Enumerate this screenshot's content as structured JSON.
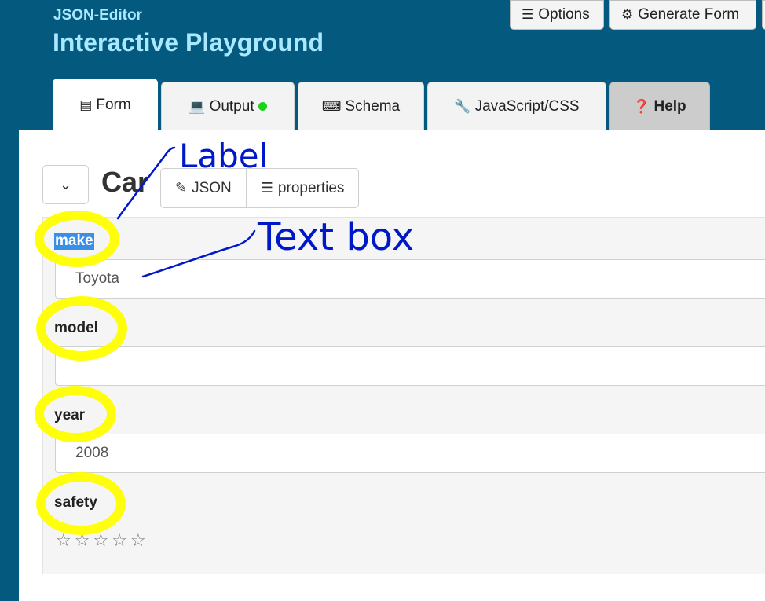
{
  "header": {
    "brand_small": "JSON-Editor",
    "brand_title": "Interactive Playground",
    "options_label": "Options",
    "generate_label": "Generate Form"
  },
  "tabs": [
    {
      "label": "Form",
      "icon": "form-icon",
      "active": true
    },
    {
      "label": "Output",
      "icon": "laptop-icon",
      "status_color": "#18d318"
    },
    {
      "label": "Schema",
      "icon": "keyboard-icon"
    },
    {
      "label": "JavaScript/CSS",
      "icon": "wrench-icon"
    },
    {
      "label": "Help",
      "icon": "question-circle-icon"
    }
  ],
  "editor": {
    "title": "Car",
    "json_button": "JSON",
    "properties_button": "properties",
    "fields": [
      {
        "label": "make",
        "value": "Toyota",
        "selected": true
      },
      {
        "label": "model",
        "value": ""
      },
      {
        "label": "year",
        "value": "2008"
      },
      {
        "label": "safety",
        "rating": 0,
        "max": 5
      }
    ]
  },
  "annotations": {
    "label_note": "Label",
    "textbox_note": "Text box",
    "highlight_color": "#ffff00",
    "ink_color": "#0019c8"
  },
  "colors": {
    "header_bg": "#035a7e",
    "brand_text": "#a9e8ff"
  }
}
